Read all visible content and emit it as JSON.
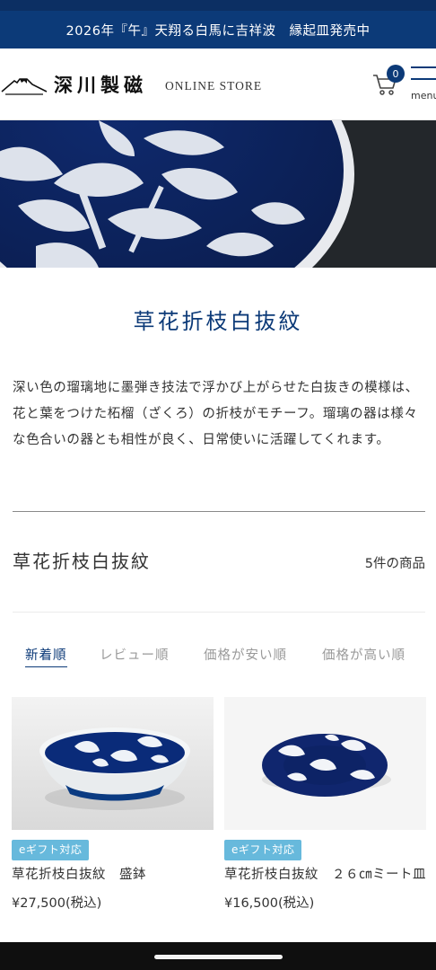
{
  "announcement": "2026年『午』天翔る白馬に吉祥波　縁起皿発売中",
  "header": {
    "logo_text": "深川製磁",
    "store_text": "ONLINE STORE",
    "cart_count": "0",
    "menu_label": "menu"
  },
  "page_title": "草花折枝白抜紋",
  "description": "深い色の瑠璃地に墨弾き技法で浮かび上がらせた白抜きの模様は、花と葉をつけた柘榴（ざくろ）の折枝がモチーフ。瑠璃の器は様々な色合いの器とも相性が良く、日常使いに活躍してくれます。",
  "section": {
    "title": "草花折枝白抜紋",
    "count": "5件の商品"
  },
  "sort": {
    "items": [
      "新着順",
      "レビュー順",
      "価格が安い順",
      "価格が高い順"
    ],
    "active": "新着順"
  },
  "products": [
    {
      "badge": "eギフト対応",
      "name": "草花折枝白抜紋　盛鉢",
      "price": "¥27,500(税込)"
    },
    {
      "badge": "eギフト対応",
      "name": "草花折枝白抜紋　２６㎝ミート皿",
      "price": "¥16,500(税込)"
    }
  ],
  "colors": {
    "brand_navy": "#0c3a78",
    "badge_blue": "#67b9dc"
  }
}
